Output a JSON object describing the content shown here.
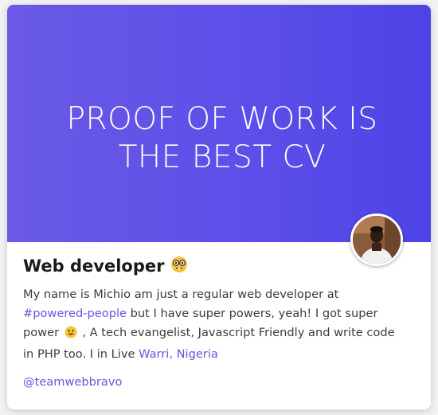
{
  "hero": {
    "title": "PROOF OF WORK IS THE BEST CV"
  },
  "profile": {
    "role": "Web developer",
    "role_emoji": "nerd-face-icon",
    "bio": {
      "part1": "My name is Michio am just a regular web developer at ",
      "link_powered": "#powered-people",
      "part2": " but I have super powers, yeah! I got super power ",
      "smile_emoji": "smiling-face-icon",
      "part3": " , A tech evangelist, Javascript Friendly and write code in PHP too. I in Live ",
      "link_location": "Warri, Nigeria"
    },
    "handle": "@teamwebbravo"
  },
  "colors": {
    "hero_gradient_start": "#6a5ae6",
    "hero_gradient_end": "#4d44e6",
    "link": "#6358e0",
    "text": "#3b3b3b"
  }
}
